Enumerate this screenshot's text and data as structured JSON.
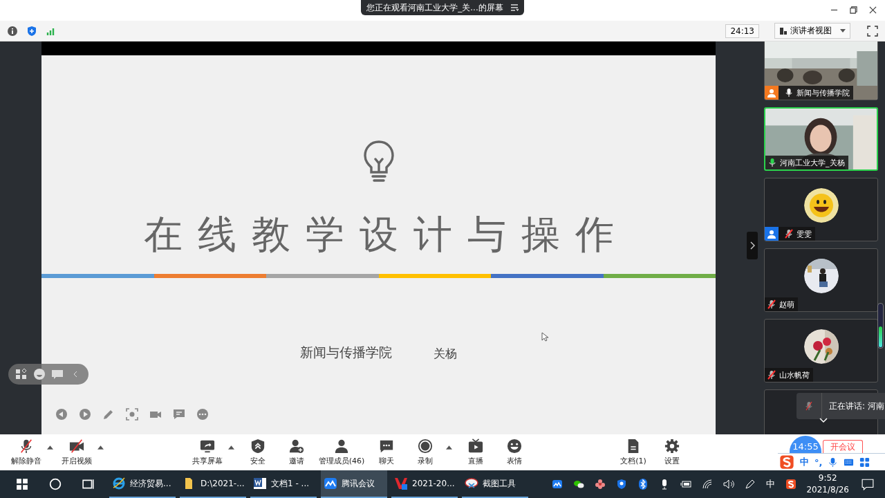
{
  "window": {
    "banner": "您正在观看河南工业大学_关...的屏幕",
    "elapsed": "24:13",
    "view_mode": "演讲者视图"
  },
  "slide": {
    "title": "在线教学设计与操作",
    "department": "新闻与传播学院",
    "author": "关杨"
  },
  "tiles": [
    {
      "kind": "video",
      "name": "新闻与传播学院",
      "muted": false,
      "speaking": false,
      "selected": false,
      "color": "#f47920"
    },
    {
      "kind": "video",
      "name": "河南工业大学_关杨",
      "muted": false,
      "speaking": true,
      "selected": true
    },
    {
      "kind": "smiley",
      "name": "雯雯",
      "muted": true,
      "speaking": false,
      "selected": false,
      "color": "#1a73e8"
    },
    {
      "kind": "person",
      "name": "赵萌",
      "muted": true,
      "speaking": false,
      "selected": false
    },
    {
      "kind": "flowers",
      "name": "山水帆荷",
      "muted": true,
      "speaking": false,
      "selected": false
    },
    {
      "kind": "dark",
      "selected": false
    }
  ],
  "speaking_toast": "正在讲话: 河南",
  "toolbar": [
    {
      "kind": "mic",
      "label": "解除静音",
      "caret": true
    },
    {
      "kind": "camera",
      "label": "开启视频",
      "caret": true
    },
    {
      "kind": "share",
      "label": "共享屏幕",
      "caret": true
    },
    {
      "kind": "shield",
      "label": "安全",
      "caret": false
    },
    {
      "kind": "invite",
      "label": "邀请",
      "caret": false
    },
    {
      "kind": "members",
      "label": "管理成员(46)",
      "caret": false
    },
    {
      "kind": "chat",
      "label": "聊天",
      "caret": false
    },
    {
      "kind": "record",
      "label": "录制",
      "caret": true
    },
    {
      "kind": "live",
      "label": "直播",
      "caret": false
    },
    {
      "kind": "emoji",
      "label": "表情",
      "caret": false
    },
    {
      "kind": "doc",
      "label": "文档(1)",
      "caret": false
    },
    {
      "kind": "gear",
      "label": "设置",
      "caret": false
    }
  ],
  "meeting_timer": "14:55",
  "leave_button": "开会议",
  "ime_bar": {
    "mode": "中",
    "punct": "°,"
  },
  "taskbar": {
    "apps": [
      {
        "kind": "ie",
        "label": "经济贸易...",
        "selected": false
      },
      {
        "kind": "folder",
        "label": "D:\\2021-...",
        "selected": false
      },
      {
        "kind": "word",
        "label": "文档1 - ...",
        "selected": false
      },
      {
        "kind": "meeting",
        "label": "腾讯会议",
        "selected": true
      },
      {
        "kind": "wps",
        "label": "2021-20...",
        "selected": false
      },
      {
        "kind": "snip",
        "label": "截图工具",
        "selected": false
      }
    ],
    "input_lang": "中",
    "time": "9:52",
    "date": "2021/8/26"
  }
}
